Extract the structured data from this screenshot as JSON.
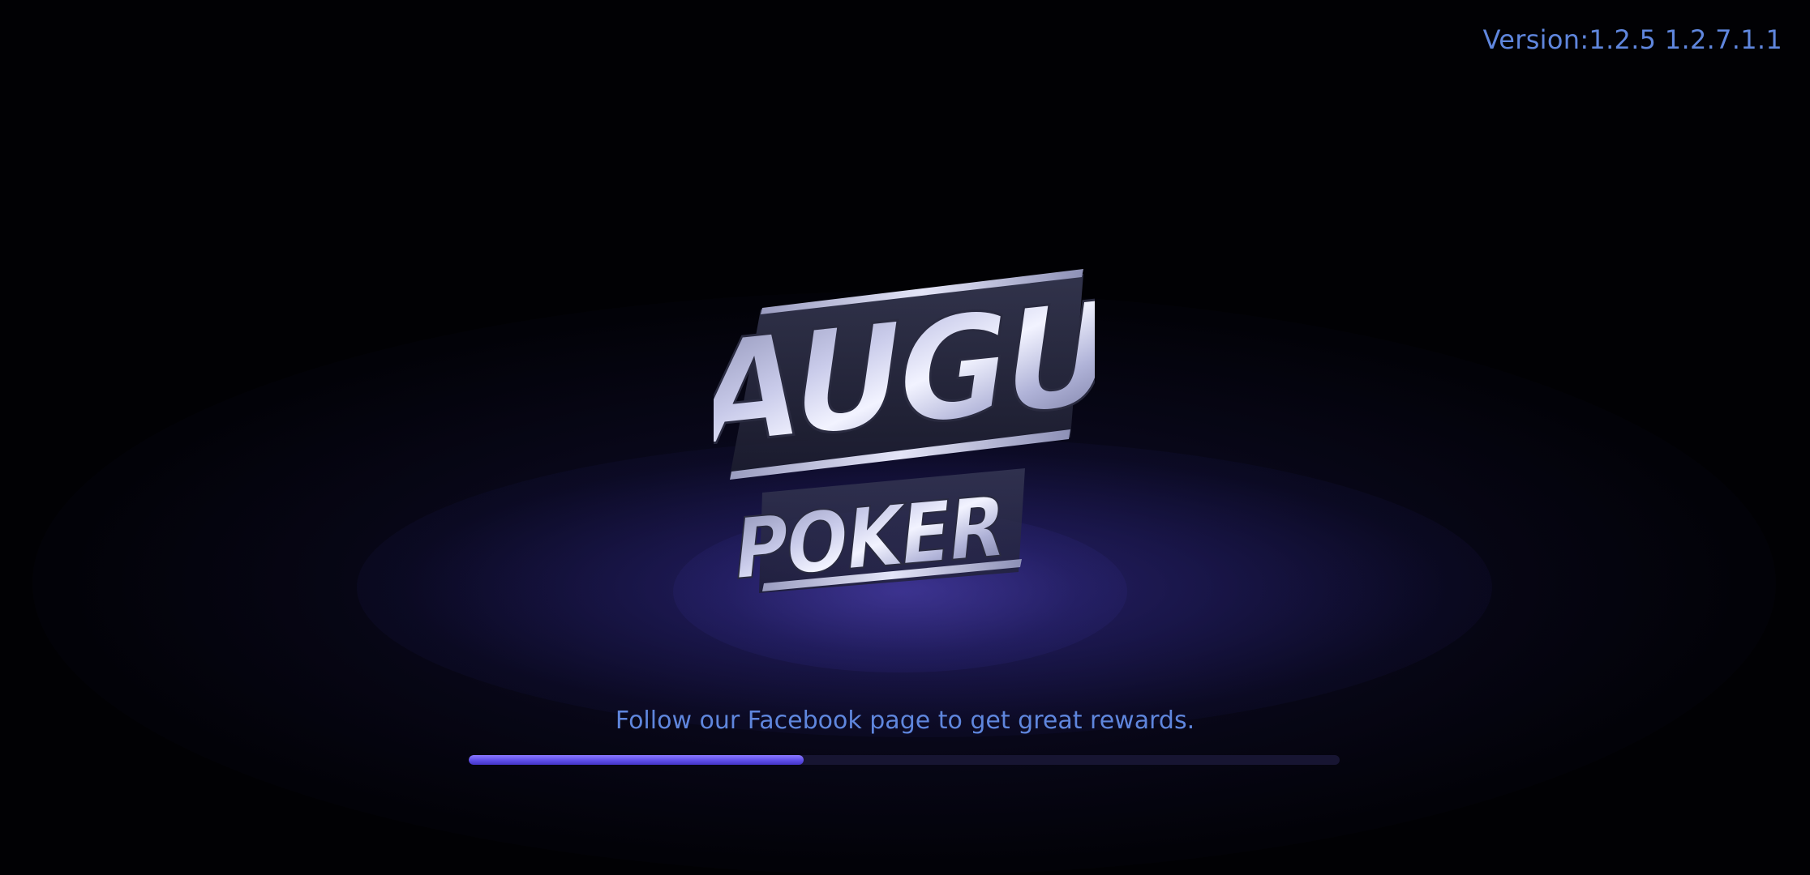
{
  "version_text": "Version:1.2.5 1.2.7.1.1",
  "logo": {
    "line1": "AUGU",
    "line2": "POKER"
  },
  "loading_tip": "Follow our Facebook page to get great rewards.",
  "progress": {
    "fraction": 0.385
  },
  "colors": {
    "background": "#010104",
    "glow": "#3e349e",
    "text_accent": "#5f86dd",
    "progress_fill": "#6a58f0",
    "progress_track": "#171532",
    "logo_silver": "#d6d8f2"
  }
}
